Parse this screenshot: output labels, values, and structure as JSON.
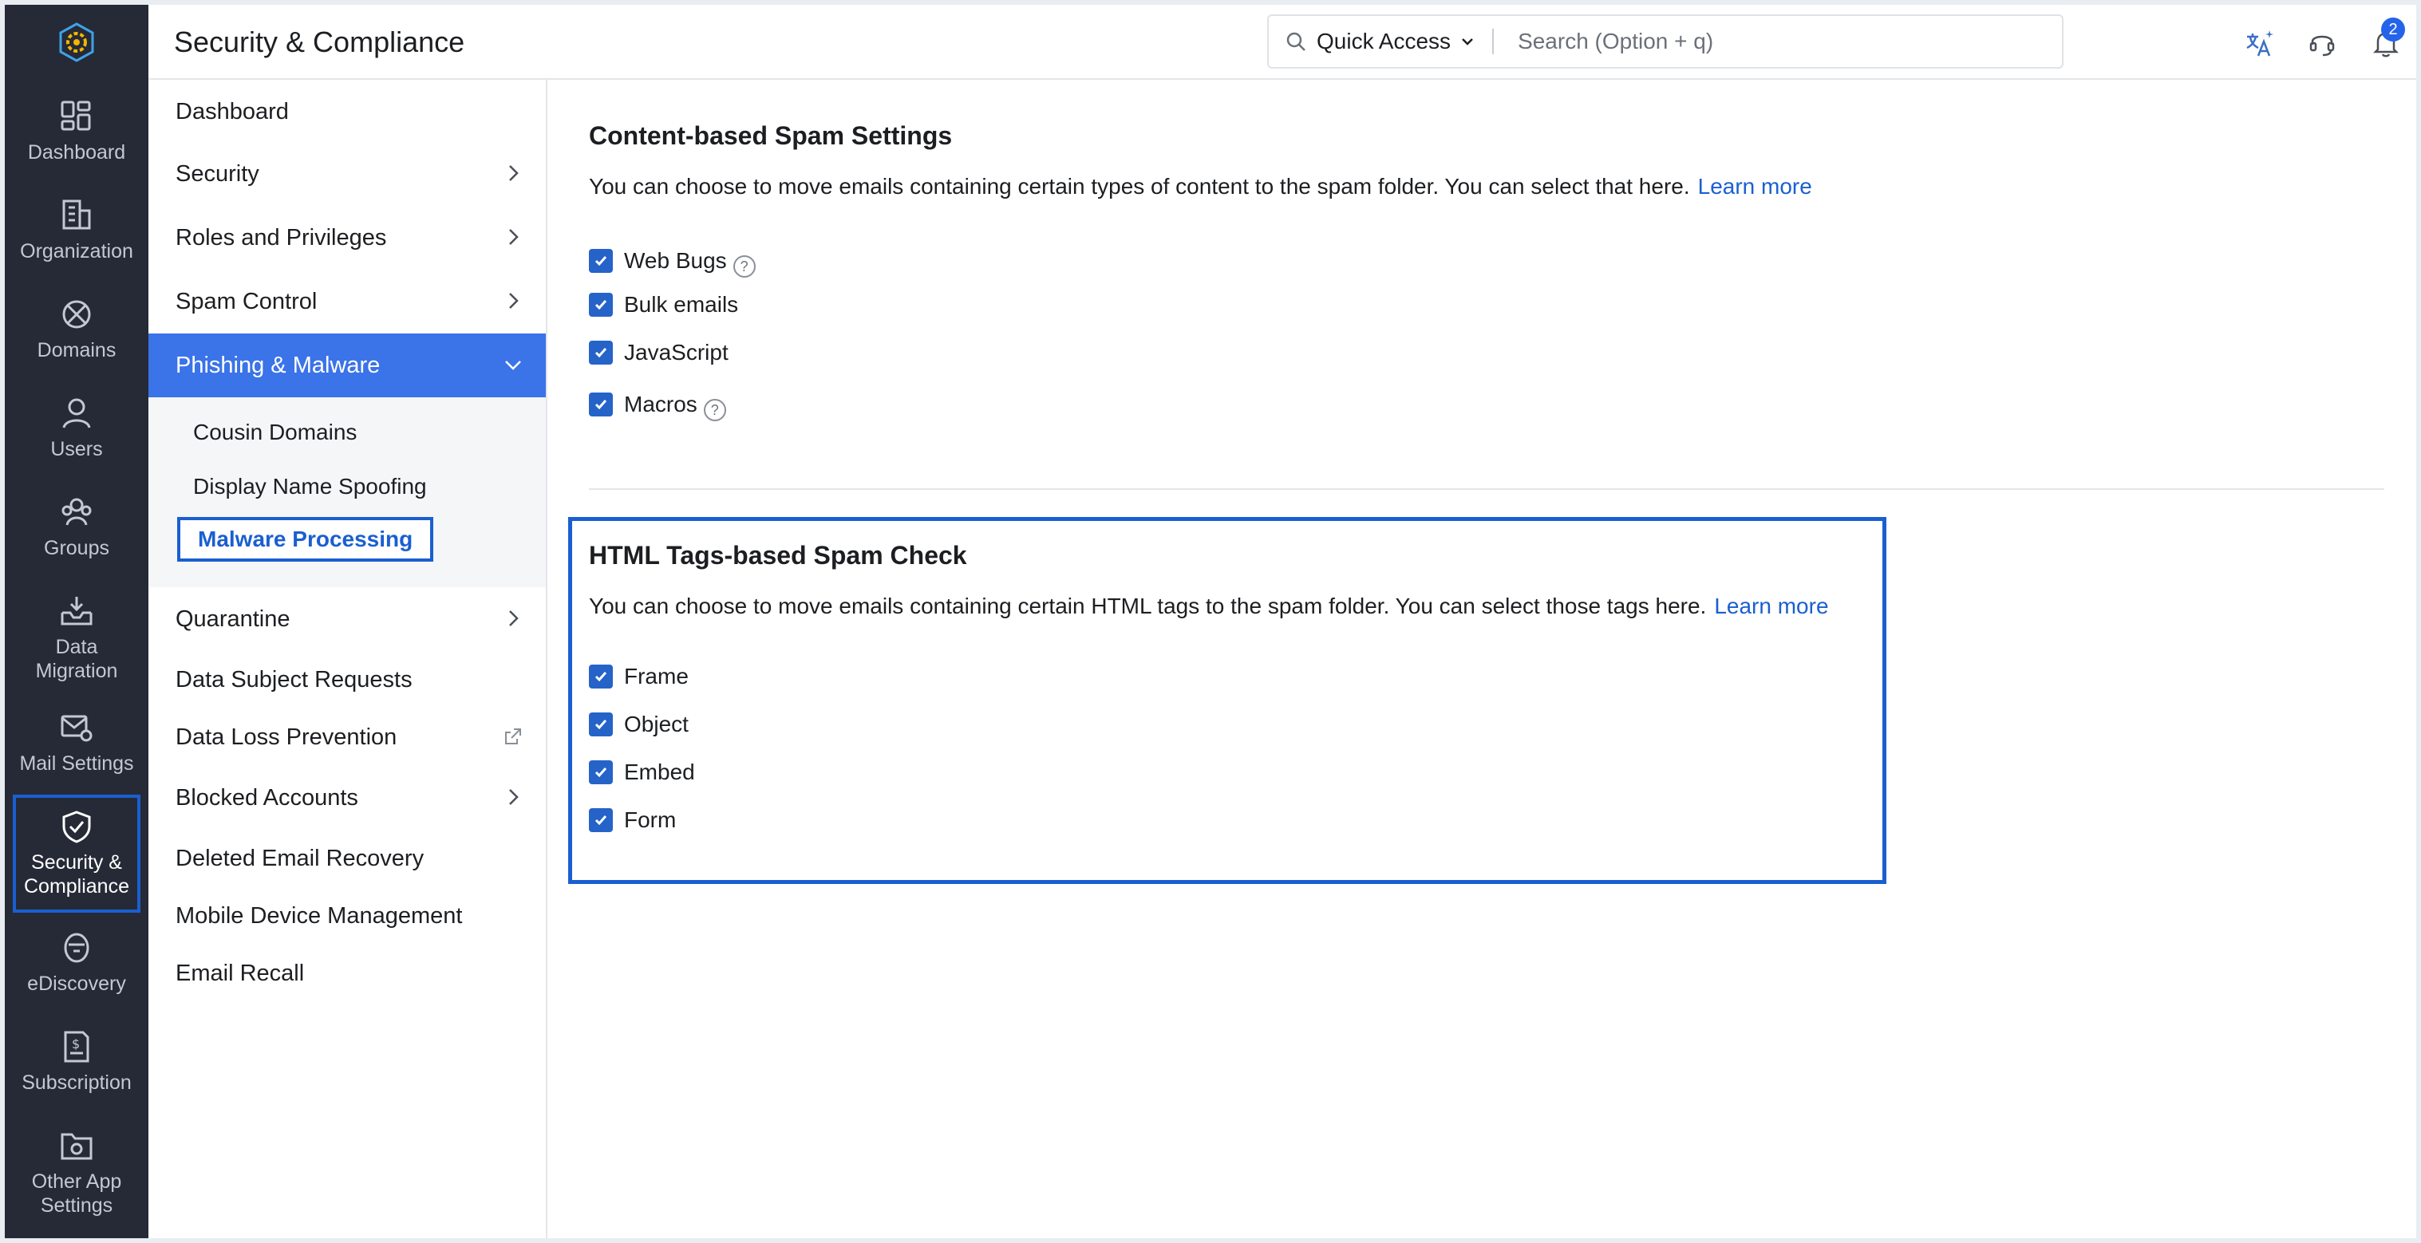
{
  "header": {
    "title": "Security & Compliance",
    "quick_access_label": "Quick Access",
    "search_placeholder": "Search (Option + q)",
    "notification_count": "2"
  },
  "rail": {
    "items": [
      {
        "label": "Dashboard",
        "icon": "dashboard-icon"
      },
      {
        "label": "Organization",
        "icon": "building-icon"
      },
      {
        "label": "Domains",
        "icon": "globe-icon"
      },
      {
        "label": "Users",
        "icon": "user-icon"
      },
      {
        "label": "Groups",
        "icon": "groups-icon"
      },
      {
        "label": "Data Migration",
        "icon": "inbox-download-icon"
      },
      {
        "label": "Mail Settings",
        "icon": "mail-gear-icon"
      },
      {
        "label": "Security & Compliance",
        "icon": "shield-check-icon"
      },
      {
        "label": "eDiscovery",
        "icon": "archive-icon"
      },
      {
        "label": "Subscription",
        "icon": "invoice-icon"
      },
      {
        "label": "Other App Settings",
        "icon": "folder-gear-icon"
      }
    ]
  },
  "subnav": {
    "dashboard": "Dashboard",
    "security": "Security",
    "roles": "Roles and Privileges",
    "spam": "Spam Control",
    "phishing": "Phishing & Malware",
    "cousin": "Cousin Domains",
    "spoofing": "Display Name Spoofing",
    "malware": "Malware Processing",
    "quarantine": "Quarantine",
    "dsr": "Data Subject Requests",
    "dlp": "Data Loss Prevention",
    "blocked": "Blocked Accounts",
    "deleted": "Deleted Email Recovery",
    "mdm": "Mobile Device Management",
    "recall": "Email Recall"
  },
  "content_spam": {
    "title": "Content-based Spam Settings",
    "description": "You can choose to move emails containing certain types of content to the spam folder. You can select that here.",
    "learn_more": "Learn more",
    "options": [
      {
        "label": "Web Bugs",
        "checked": true,
        "help": "?"
      },
      {
        "label": "Bulk emails",
        "checked": true
      },
      {
        "label": "JavaScript",
        "checked": true
      },
      {
        "label": "Macros",
        "checked": true,
        "help": "?"
      }
    ]
  },
  "html_spam": {
    "title": "HTML Tags-based Spam Check",
    "description": "You can choose to move emails containing certain HTML tags to the spam folder. You can select those tags here.",
    "learn_more": "Learn more",
    "options": [
      {
        "label": "Frame",
        "checked": true
      },
      {
        "label": "Object",
        "checked": true
      },
      {
        "label": "Embed",
        "checked": true
      },
      {
        "label": "Form",
        "checked": true
      }
    ]
  },
  "colors": {
    "rail_bg": "#252a36",
    "accent": "#1a5fd1",
    "active_nav": "#3b73e8",
    "checkbox": "#2563c9"
  }
}
